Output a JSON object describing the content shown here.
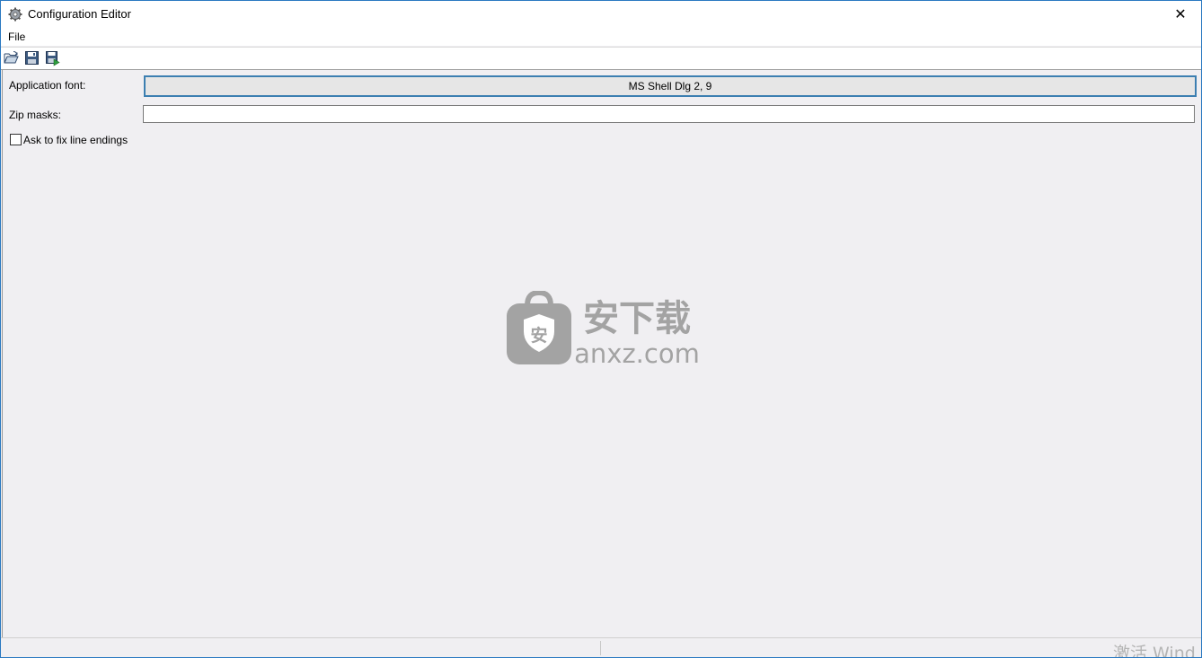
{
  "window": {
    "title": "Configuration Editor",
    "icon": "gear-icon",
    "close_glyph": "✕"
  },
  "menubar": {
    "items": [
      {
        "label": "File"
      }
    ]
  },
  "toolbar": {
    "buttons": [
      {
        "name": "open-icon"
      },
      {
        "name": "save-icon"
      },
      {
        "name": "save-as-icon"
      }
    ]
  },
  "form": {
    "application_font_label": "Application font:",
    "application_font_value": "MS Shell Dlg 2, 9",
    "zip_masks_label": "Zip masks:",
    "zip_masks_value": "",
    "fix_line_endings_label": "Ask to fix line endings",
    "fix_line_endings_checked": false
  },
  "watermark": {
    "brand_cn": "安下载",
    "domain": "anxz.com",
    "shield_char": "安"
  },
  "statusbar": {
    "activation_text": "激活 Wind"
  },
  "colors": {
    "accent_border": "#2b79c1",
    "background": "#f0eff2",
    "font_button_border": "#3c7fb1"
  }
}
